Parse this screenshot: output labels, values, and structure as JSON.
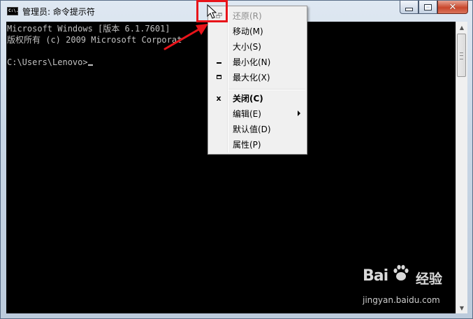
{
  "window": {
    "title": "管理员: 命令提示符",
    "icon_text": "C:\\.",
    "icon": "cmd-icon"
  },
  "caption_buttons": {
    "minimize_icon": "minimize-icon",
    "maximize_icon": "maximize-icon",
    "close_icon": "close-icon"
  },
  "console": {
    "lines": [
      "Microsoft Windows [版本 6.1.7601]",
      "版权所有 (c) 2009 Microsoft Corporat",
      "",
      "C:\\Users\\Lenovo>"
    ]
  },
  "system_menu": {
    "items": [
      {
        "label": "还原(R)",
        "icon": "restore-icon",
        "enabled": false
      },
      {
        "label": "移动(M)",
        "icon": "",
        "enabled": true
      },
      {
        "label": "大小(S)",
        "icon": "",
        "enabled": true
      },
      {
        "label": "最小化(N)",
        "icon": "minimize-icon",
        "enabled": true
      },
      {
        "label": "最大化(X)",
        "icon": "maximize-icon",
        "enabled": true
      },
      {
        "label": "关闭(C)",
        "icon": "close-icon",
        "enabled": true,
        "bold": true
      },
      {
        "label": "编辑(E)",
        "icon": "",
        "enabled": true,
        "submenu": true
      },
      {
        "label": "默认值(D)",
        "icon": "",
        "enabled": true
      },
      {
        "label": "属性(P)",
        "icon": "",
        "enabled": true
      }
    ]
  },
  "annotation": {
    "highlight_color": "#e8141a",
    "arrow_color": "#e8141a"
  },
  "watermark": {
    "logo": "Bai",
    "logo_suffix": "",
    "brand": "经验",
    "url": "jingyan.baidu.com"
  },
  "colors": {
    "console_bg": "#000000",
    "console_text": "#c0c0c0",
    "close_button": "#c8472c"
  }
}
